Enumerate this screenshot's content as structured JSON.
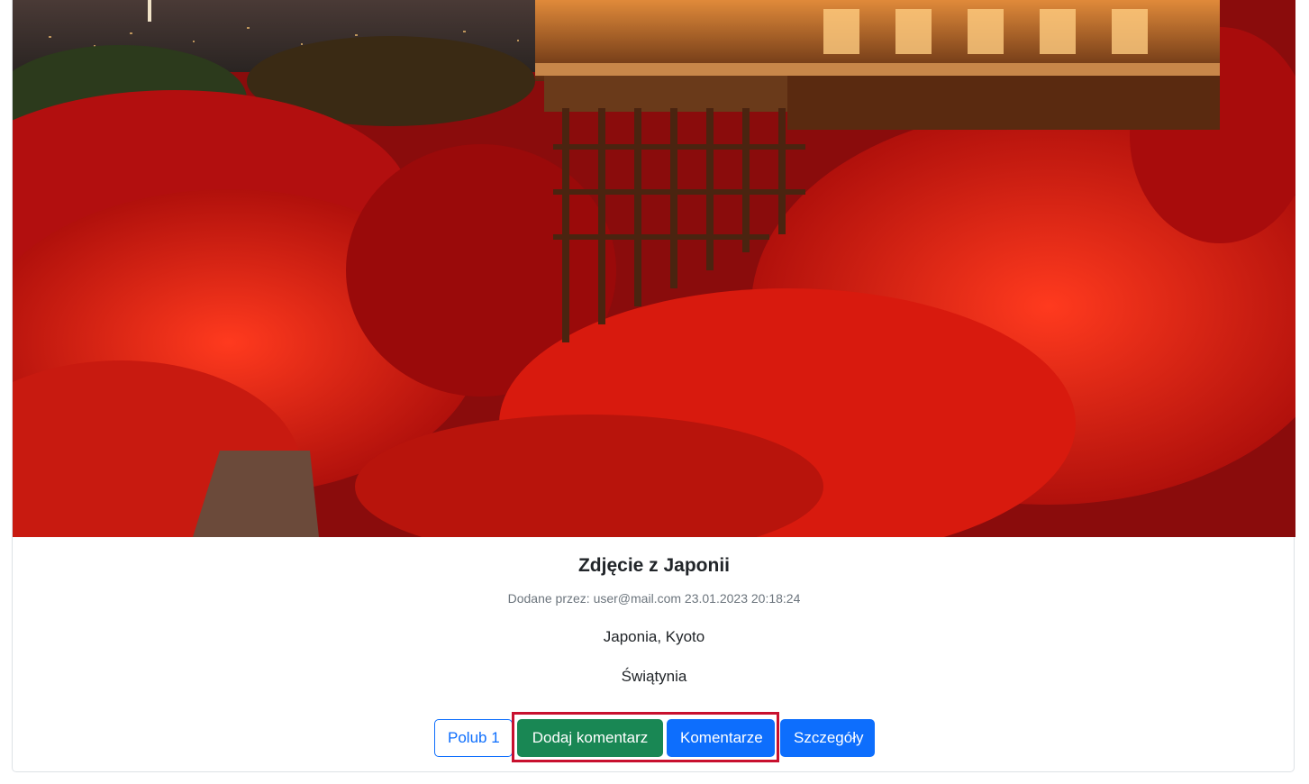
{
  "photo": {
    "alt": "Jesienne czerwone klony wokół drewnianej świątyni w Kioto nocą",
    "colors": {
      "foliage": "#d4100f",
      "temple": "#7a3a12",
      "sky": "#3b2d2a"
    }
  },
  "post": {
    "title": "Zdjęcie z Japonii",
    "meta": "Dodane przez: user@mail.com 23.01.2023 20:18:24",
    "location": "Japonia, Kyoto",
    "category": "Świątynia"
  },
  "actions": {
    "like_label": "Polub 1",
    "add_comment_label": "Dodaj komentarz",
    "comments_label": "Komentarze",
    "details_label": "Szczegóły"
  },
  "colors": {
    "primary": "#0d6efd",
    "success": "#198754",
    "highlight": "#c8102e"
  }
}
